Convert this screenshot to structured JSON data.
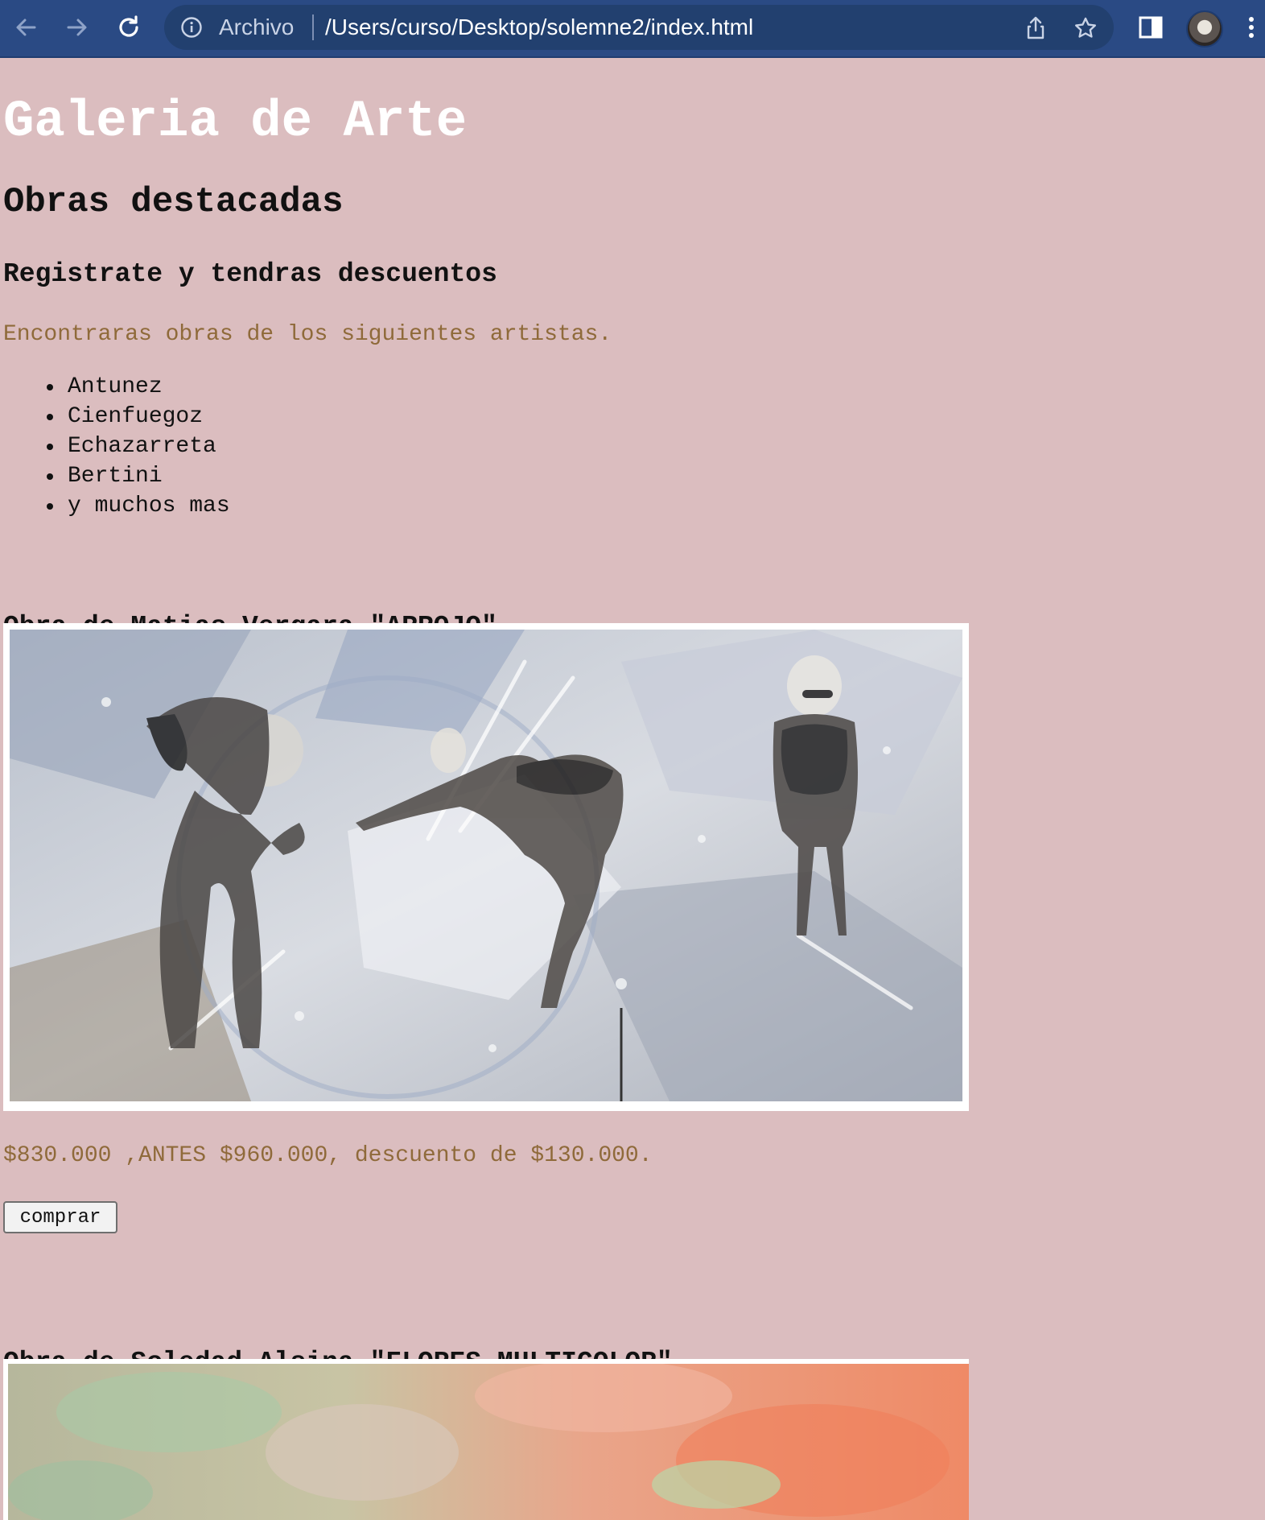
{
  "browser": {
    "scheme_label": "Archivo",
    "url": "/Users/curso/Desktop/solemne2/index.html"
  },
  "page": {
    "title": "Galeria de Arte",
    "subtitle": "Obras destacadas",
    "promo": "Registrate y tendras descuentos",
    "intro": "Encontraras obras de los siguientes artistas.",
    "artists": [
      "Antunez",
      "Cienfuegoz",
      "Echazarreta",
      "Bertini",
      "y muchos mas"
    ],
    "works": [
      {
        "heading": "Obra de Matias Vergara \"ARROJO\"",
        "price": "$830.000 ,ANTES $960.000, descuento de $130.000.",
        "buy_label": "comprar"
      },
      {
        "heading": "Obra de Soledad Alsina \"FLORES MULTICOLOR\""
      }
    ]
  },
  "colors": {
    "background": "#dbbdbf",
    "chrome": "#2a4a84",
    "accent_text": "#8f6a3a"
  }
}
